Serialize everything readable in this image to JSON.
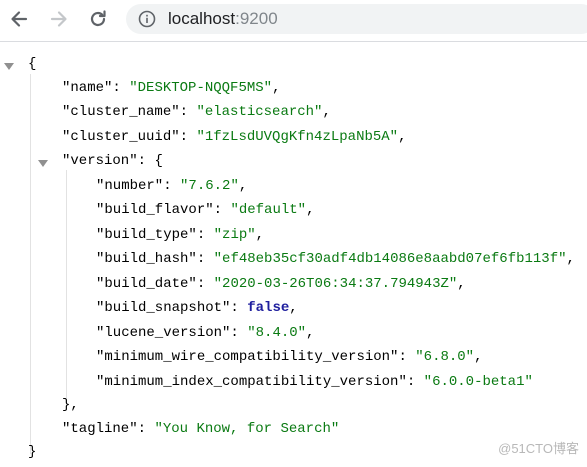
{
  "browser": {
    "url_host": "localhost",
    "url_port": ":9200",
    "icons": [
      "back-arrow-icon",
      "forward-arrow-icon",
      "reload-icon",
      "info-icon"
    ]
  },
  "json": {
    "open_brace": "{",
    "close_brace": "}",
    "version_close": "},",
    "root": [
      {
        "key": "\"name\"",
        "value": "\"DESKTOP-NQQF5MS\""
      },
      {
        "key": "\"cluster_name\"",
        "value": "\"elasticsearch\""
      },
      {
        "key": "\"cluster_uuid\"",
        "value": "\"1fzLsdUVQgKfn4zLpaNb5A\""
      }
    ],
    "version_key": "\"version\"",
    "version": [
      {
        "key": "\"number\"",
        "value": "\"7.6.2\"",
        "type": "string"
      },
      {
        "key": "\"build_flavor\"",
        "value": "\"default\"",
        "type": "string"
      },
      {
        "key": "\"build_type\"",
        "value": "\"zip\"",
        "type": "string"
      },
      {
        "key": "\"build_hash\"",
        "value": "\"ef48eb35cf30adf4db14086e8aabd07ef6fb113f\"",
        "type": "string"
      },
      {
        "key": "\"build_date\"",
        "value": "\"2020-03-26T06:34:37.794943Z\"",
        "type": "string"
      },
      {
        "key": "\"build_snapshot\"",
        "value": "false",
        "type": "bool"
      },
      {
        "key": "\"lucene_version\"",
        "value": "\"8.4.0\"",
        "type": "string"
      },
      {
        "key": "\"minimum_wire_compatibility_version\"",
        "value": "\"6.8.0\"",
        "type": "string"
      },
      {
        "key": "\"minimum_index_compatibility_version\"",
        "value": "\"6.0.0-beta1\"",
        "type": "string"
      }
    ],
    "tagline": {
      "key": "\"tagline\"",
      "value": "\"You Know, for Search\""
    }
  },
  "watermark": "@51CTO博客",
  "colors": {
    "string": "#0a7a12",
    "boolean": "#1f1f9e",
    "key": "#000000"
  }
}
